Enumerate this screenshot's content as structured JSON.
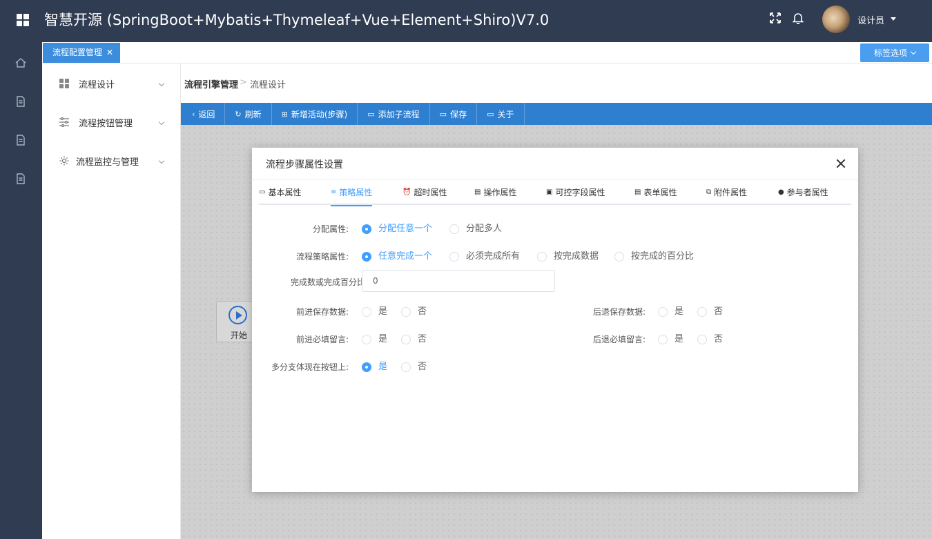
{
  "app": {
    "title": "智慧开源 (SpringBoot+Mybatis+Thymeleaf+Vue+Element+Shiro)V7.0",
    "user_name": "设计员"
  },
  "tabs": {
    "active_label": "流程配置管理",
    "close_glyph": "✕",
    "options_label": "标签选项"
  },
  "rail_icons": [
    "home-icon",
    "document-icon",
    "document-icon",
    "document-icon"
  ],
  "menu": {
    "items": [
      {
        "label": "流程设计",
        "icon": "grid-icon"
      },
      {
        "label": "流程按钮管理",
        "icon": "sliders-icon"
      },
      {
        "label": "流程监控与管理",
        "icon": "gear-icon"
      }
    ]
  },
  "breadcrumb": {
    "level1": "流程引擎管理",
    "separator": ">",
    "level2": "流程设计"
  },
  "toolbar": {
    "buttons": [
      {
        "label": "返回",
        "glyph": "‹"
      },
      {
        "label": "刷新",
        "glyph": "↻"
      },
      {
        "label": "新增活动(步骤)",
        "glyph": "⊞"
      },
      {
        "label": "添加子流程",
        "glyph": "▭"
      },
      {
        "label": "保存",
        "glyph": "▭"
      },
      {
        "label": "关于",
        "glyph": "▭"
      }
    ]
  },
  "canvas": {
    "start_label": "开始"
  },
  "dialog": {
    "title": "流程步骤属性设置",
    "tabs": [
      {
        "label": "基本属性",
        "glyph": "▭"
      },
      {
        "label": "策略属性",
        "glyph": "≡"
      },
      {
        "label": "超时属性",
        "glyph": "⏰"
      },
      {
        "label": "操作属性",
        "glyph": "▤"
      },
      {
        "label": "可控字段属性",
        "glyph": "▣"
      },
      {
        "label": "表单属性",
        "glyph": "▤"
      },
      {
        "label": "附件属性",
        "glyph": "⧉"
      },
      {
        "label": "参与者属性",
        "glyph": "●"
      }
    ],
    "active_tab": "策略属性",
    "form": {
      "assign_label": "分配属性:",
      "assign_opt1": "分配任意一个",
      "assign_opt2": "分配多人",
      "strategy_label": "流程策略属性:",
      "strategy_opt1": "任意完成一个",
      "strategy_opt2": "必须完成所有",
      "strategy_opt3": "按完成数据",
      "strategy_opt4": "按完成的百分比",
      "count_label": "完成数或完成百分比:",
      "count_value": "0",
      "fwd_save_label": "前进保存数据:",
      "back_save_label": "后退保存数据:",
      "fwd_msg_label": "前进必填留言:",
      "back_msg_label": "后退必填留言:",
      "branch_label": "多分支体现在按钮上:",
      "yes": "是",
      "no": "否"
    }
  }
}
